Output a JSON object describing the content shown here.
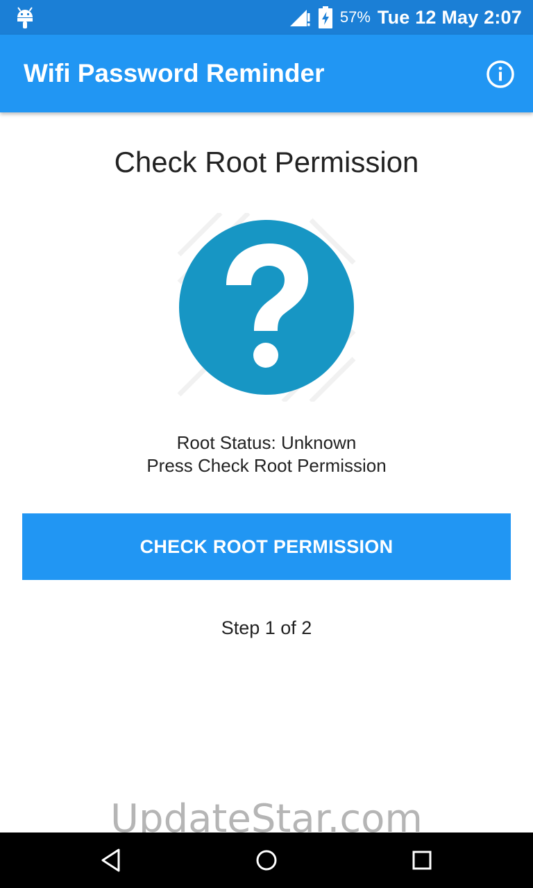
{
  "status_bar": {
    "battery_percent": "57%",
    "datetime": "Tue 12 May 2:07",
    "icons": [
      "android-icon",
      "signal-icon",
      "battery-icon"
    ]
  },
  "app_bar": {
    "title": "Wifi Password Reminder",
    "info_icon": "info-icon"
  },
  "main": {
    "heading": "Check Root Permission",
    "status_icon": "question-mark-icon",
    "status_line": "Root Status: Unknown",
    "instruction_line": "Press Check Root Permission",
    "button_label": "CHECK ROOT PERMISSION",
    "step_text": "Step 1 of 2"
  },
  "watermark": "UpdateStar.com",
  "nav_bar": {
    "icons": [
      "back-icon",
      "home-icon",
      "recents-icon"
    ]
  },
  "colors": {
    "status_bar": "#1b7fd6",
    "app_bar": "#2196f3",
    "button": "#2196f3",
    "icon_circle": "#1796c4",
    "nav_bar": "#000000"
  }
}
